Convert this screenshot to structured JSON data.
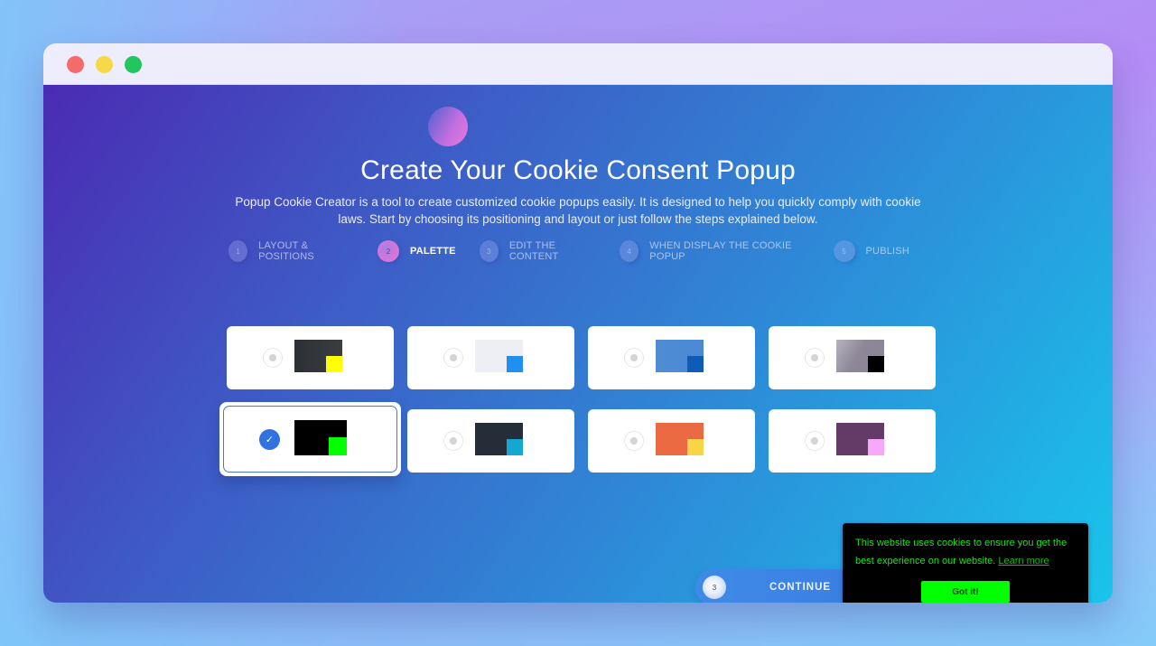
{
  "window": {
    "controls": [
      "close",
      "minimize",
      "maximize"
    ]
  },
  "hero": {
    "title": "Create Your Cookie Consent Popup",
    "subtitle": "Popup Cookie Creator is a tool to create customized cookie popups easily. It is designed to help you quickly comply with cookie laws. Start by choosing its positioning and layout or just follow the steps explained below."
  },
  "steps": [
    {
      "num": "1",
      "label": "LAYOUT & POSITIONS",
      "active": false
    },
    {
      "num": "2",
      "label": "PALETTE",
      "active": true
    },
    {
      "num": "3",
      "label": "EDIT THE CONTENT",
      "active": false
    },
    {
      "num": "4",
      "label": "WHEN DISPLAY THE COOKIE POPUP",
      "active": false
    },
    {
      "num": "5",
      "label": "PUBLISH",
      "active": false
    }
  ],
  "palettes": [
    {
      "bg": "linear-gradient(90deg,#2c2f33,#3a3d42)",
      "accent": "#ffff00",
      "selected": false
    },
    {
      "bg": "#edeff4",
      "accent": "#1f8ff0",
      "selected": false
    },
    {
      "bg": "linear-gradient(90deg,#4f8cd4,#4b89d6)",
      "accent": "#0e5cb6",
      "selected": false
    },
    {
      "bg": "linear-gradient(120deg,#b7b3bd,#8d8798 45%,#8a8496)",
      "accent": "#000000",
      "selected": false
    },
    {
      "bg": "#000000",
      "accent": "#00ff00",
      "selected": true
    },
    {
      "bg": "#252e38",
      "accent": "#14a7d0",
      "selected": false
    },
    {
      "bg": "#eb6a44",
      "accent": "#f7d547",
      "selected": false
    },
    {
      "bg": "#643a67",
      "accent": "#f6a8f9",
      "selected": false
    }
  ],
  "continue_button": {
    "num": "3",
    "label": "CONTINUE"
  },
  "cookie_popup": {
    "message": "This website uses cookies to ensure you get the best experience on our website. ",
    "link": "Learn more",
    "button": "Got it!",
    "colors": {
      "background": "#000000",
      "text": "#1fe01f",
      "button": "#00ff00"
    }
  }
}
